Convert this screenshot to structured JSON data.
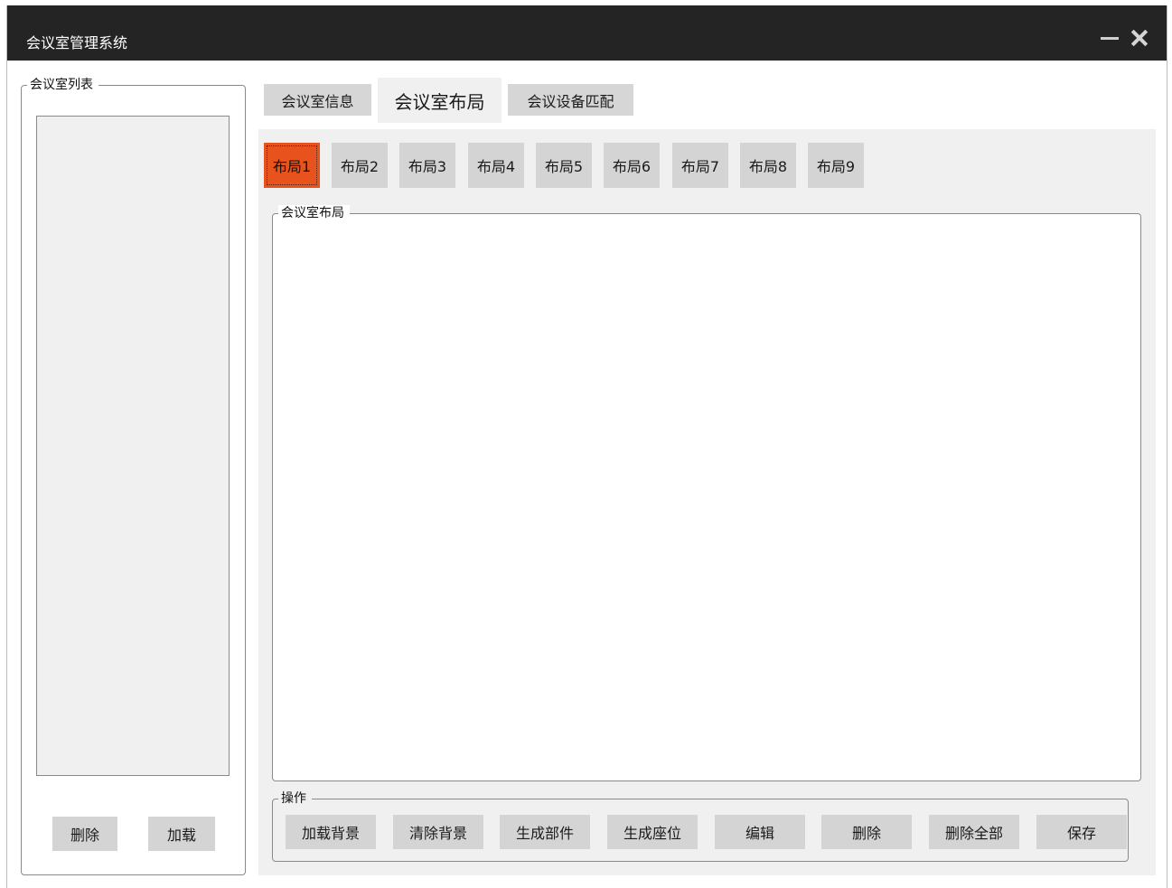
{
  "window": {
    "title": "会议室管理系统"
  },
  "sidebar": {
    "legend": "会议室列表",
    "delete_label": "删除",
    "load_label": "加载"
  },
  "tabs": [
    {
      "label": "会议室信息"
    },
    {
      "label": "会议室布局",
      "active": true
    },
    {
      "label": "会议设备匹配"
    }
  ],
  "layouts": {
    "selected": "布局1",
    "items": [
      "布局1",
      "布局2",
      "布局3",
      "布局4",
      "布局5",
      "布局6",
      "布局7",
      "布局8",
      "布局9"
    ]
  },
  "layout_panel": {
    "legend": "会议室布局"
  },
  "operations": {
    "legend": "操作",
    "buttons": [
      "加载背景",
      "清除背景",
      "生成部件",
      "生成座位",
      "编辑",
      "删除",
      "删除全部",
      "保存"
    ]
  },
  "colors": {
    "titlebar": "#242424",
    "selected_layout": "#e8521d"
  },
  "icons": {
    "minimize": "minimize-icon",
    "close": "close-icon"
  }
}
